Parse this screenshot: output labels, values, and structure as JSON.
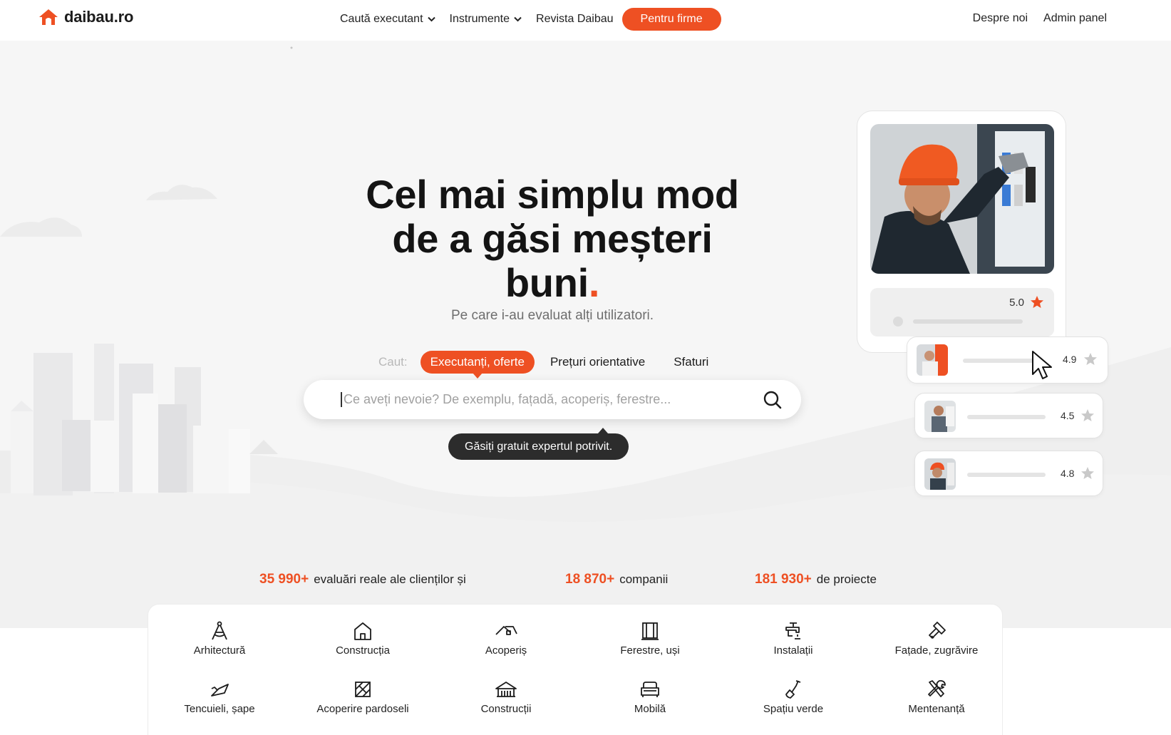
{
  "brand": {
    "name": "daibau.ro",
    "accent": "#ee5023"
  },
  "nav": {
    "items": [
      {
        "label": "Caută executant",
        "dropdown": true
      },
      {
        "label": "Instrumente",
        "dropdown": true
      },
      {
        "label": "Revista Daibau",
        "dropdown": false
      }
    ],
    "cta": "Pentru firme",
    "right": [
      "Despre noi",
      "Admin panel"
    ]
  },
  "hero": {
    "title_line1": "Cel mai simplu mod",
    "title_line2": "de a găsi meșteri",
    "title_line3": "buni",
    "title_dot": ".",
    "subtitle": "Pe care i-au evaluat alți utilizatori.",
    "tabs_label": "Caut:",
    "tabs": [
      "Executanți, oferte",
      "Prețuri orientative",
      "Sfaturi"
    ],
    "active_tab": "Executanți, oferte",
    "search_placeholder": "Ce aveți nevoie? De exemplu, fațadă, acoperiș, ferestre...",
    "search_value": "",
    "tooltip": "Găsiți gratuit expertul potrivit."
  },
  "ratings": {
    "main": "5.0",
    "cards": [
      "4.9",
      "4.5",
      "4.8"
    ]
  },
  "stats": [
    {
      "number": "35 990+",
      "text": "evaluări reale ale clienților și"
    },
    {
      "number": "18 870+",
      "text": "companii"
    },
    {
      "number": "181 930+",
      "text": "de proiecte"
    }
  ],
  "categories": [
    {
      "label": "Arhitectură",
      "icon": "compass-icon"
    },
    {
      "label": "Construcția",
      "icon": "house-icon"
    },
    {
      "label": "Acoperiș",
      "icon": "roof-icon"
    },
    {
      "label": "Ferestre, uși",
      "icon": "window-icon"
    },
    {
      "label": "Instalații",
      "icon": "faucet-icon"
    },
    {
      "label": "Fațade, zugrăvire",
      "icon": "paint-roller-icon"
    },
    {
      "label": "Tencuieli, șape",
      "icon": "trowel-icon"
    },
    {
      "label": "Acoperire pardoseli",
      "icon": "floor-tiles-icon"
    },
    {
      "label": "Construcții",
      "icon": "building-icon"
    },
    {
      "label": "Mobilă",
      "icon": "armchair-icon"
    },
    {
      "label": "Spațiu verde",
      "icon": "shovel-icon"
    },
    {
      "label": "Mentenanță",
      "icon": "tools-icon"
    }
  ]
}
